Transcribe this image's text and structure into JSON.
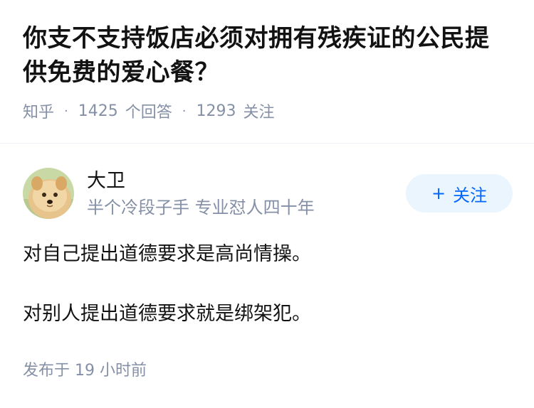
{
  "question": {
    "title": "你支不支持饭店必须对拥有残疾证的公民提供免费的爱心餐？",
    "source": "知乎",
    "answer_count": "1425",
    "answer_label": "个回答",
    "follower_count": "1293",
    "follower_label": "关注"
  },
  "answer": {
    "author_name": "大卫",
    "author_bio": "半个冷段子手 专业怼人四十年",
    "follow_label": "关注",
    "paragraphs": [
      "对自己提出道德要求是高尚情操。",
      "对别人提出道德要求就是绑架犯。"
    ],
    "published": "发布于  19 小时前"
  },
  "colors": {
    "accent": "#0066ff",
    "button_bg": "#ebf5fd",
    "meta_gray": "#8590a6",
    "text": "#121212"
  },
  "icons": {
    "follow": "plus-icon",
    "avatar": "dog-avatar"
  }
}
